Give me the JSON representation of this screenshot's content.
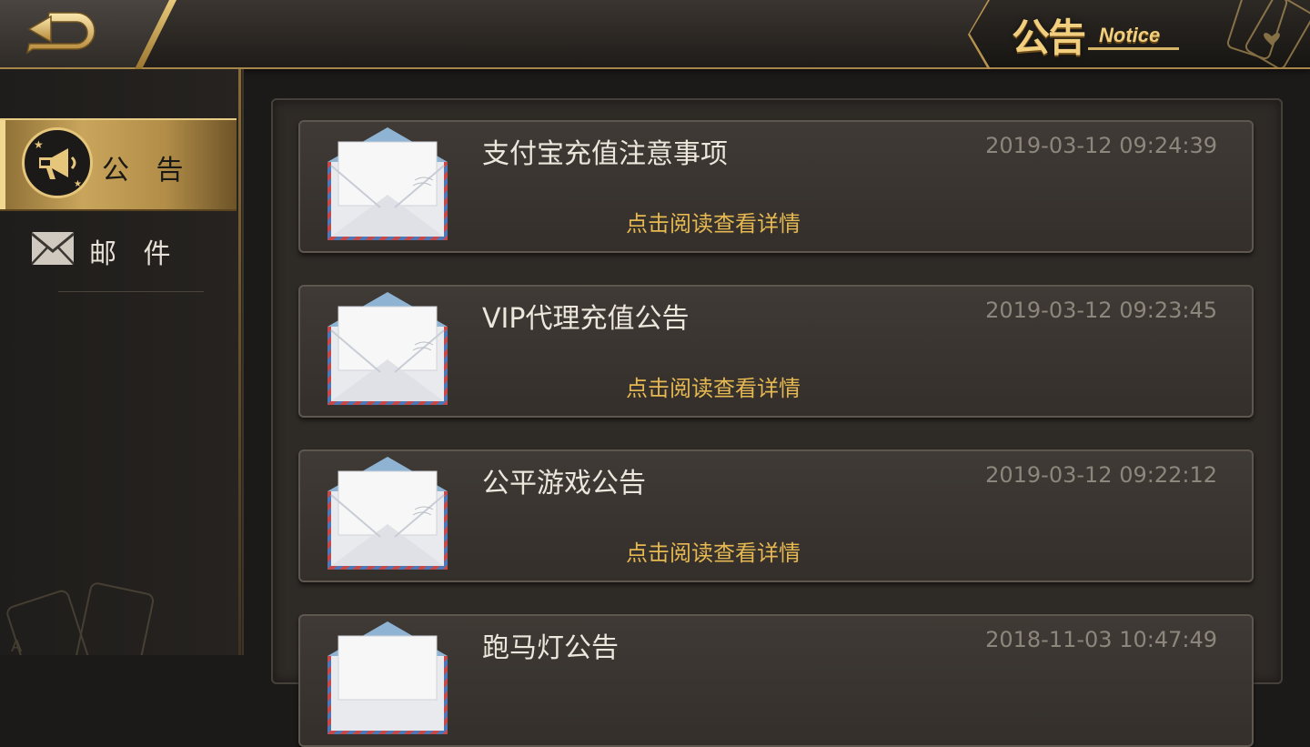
{
  "header": {
    "title_cn": "公告",
    "title_en": "Notice"
  },
  "sidebar": {
    "items": [
      {
        "label": "公 告",
        "active": true,
        "icon": "megaphone-icon"
      },
      {
        "label": "邮 件",
        "active": false,
        "icon": "mail-icon"
      }
    ]
  },
  "notices": [
    {
      "title": "支付宝充值注意事项",
      "time": "2019-03-12 09:24:39",
      "link": "点击阅读查看详情"
    },
    {
      "title": "VIP代理充值公告",
      "time": "2019-03-12 09:23:45",
      "link": "点击阅读查看详情"
    },
    {
      "title": "公平游戏公告",
      "time": "2019-03-12 09:22:12",
      "link": "点击阅读查看详情"
    },
    {
      "title": "跑马灯公告",
      "time": "2018-11-03 10:47:49",
      "link": ""
    }
  ],
  "colors": {
    "accent_gold": "#e5b851",
    "title_gold": "#f1cf7e",
    "panel_bg": "#2e2a26",
    "item_bg": "#3a3531"
  }
}
